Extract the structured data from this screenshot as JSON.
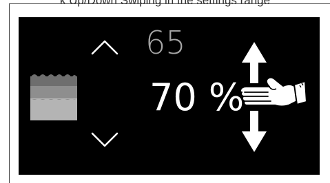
{
  "caption": "k  Up/Down Swiping in the settings range",
  "humidity": {
    "previous_value": "65",
    "current_value": "70",
    "unit": "%"
  },
  "icons": {
    "humidity": "humidity-layers-icon",
    "up": "chevron-up-icon",
    "down": "chevron-down-icon",
    "swipe": "vertical-double-arrow-icon",
    "hand": "pointing-hand-icon"
  },
  "colors": {
    "display_bg": "#000000",
    "current_text": "#ffffff",
    "previous_text": "#a6a6a6",
    "humidity_layers": [
      "#6e6e6e",
      "#8e8e8e",
      "#b4b4b4"
    ]
  }
}
